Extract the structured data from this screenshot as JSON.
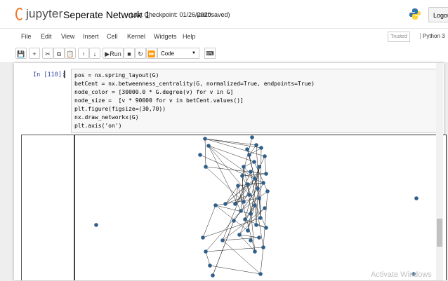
{
  "header": {
    "brand": "jupyter",
    "notebook_name": "Seperate Network 1",
    "checkpoint": "Last Checkpoint: 01/26/2020",
    "autosave_status": "(autosaved)",
    "logout_label": "Logout"
  },
  "menu": {
    "items": [
      "File",
      "Edit",
      "View",
      "Insert",
      "Cell",
      "Kernel",
      "Widgets",
      "Help"
    ],
    "trusted_label": "Trusted",
    "kernel_label": "Python 3"
  },
  "toolbar": {
    "run_label": "Run",
    "cell_type": "Code"
  },
  "cell": {
    "prompt": "In [110]:",
    "code_lines": [
      "pos = nx.spring_layout(G)",
      "betCent = nx.betweenness_centrality(G, normalized=True, endpoints=True)",
      "node_color = [30000.0 * G.degree(v) for v in G]",
      "node_size =  [v * 90000 for v in betCent.values()]",
      "plt.figure(figsize=(30,70))",
      "nx.draw_networkx(G)",
      "plt.axis('on')"
    ]
  },
  "watermark": "Activate Windows",
  "colors": {
    "node": "#2e5e8a",
    "accent": "#f37726",
    "prompt": "#303f9f",
    "keyword": "#008000"
  }
}
